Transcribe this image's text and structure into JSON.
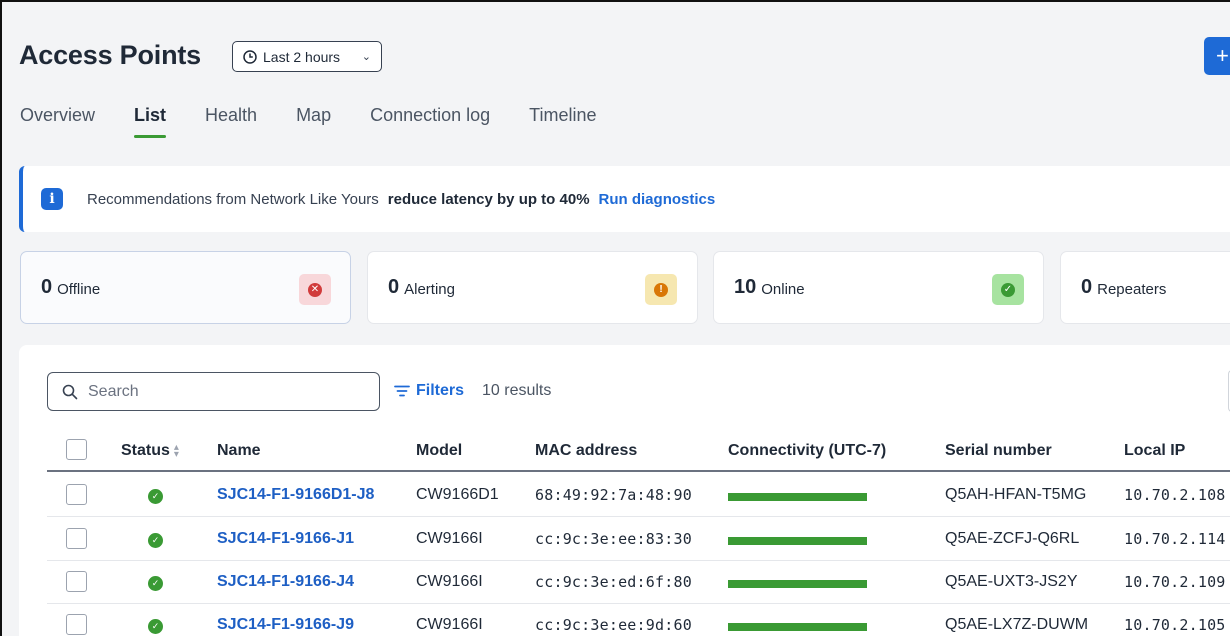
{
  "header": {
    "title": "Access Points",
    "time_range": "Last 2 hours",
    "add_button_label": "+"
  },
  "tabs": [
    {
      "label": "Overview",
      "active": false
    },
    {
      "label": "List",
      "active": true
    },
    {
      "label": "Health",
      "active": false
    },
    {
      "label": "Map",
      "active": false
    },
    {
      "label": "Connection log",
      "active": false
    },
    {
      "label": "Timeline",
      "active": false
    }
  ],
  "banner": {
    "text": "Recommendations from Network Like Yours",
    "highlight": "reduce latency by up to 40%",
    "link": "Run diagnostics",
    "icon": "info-icon"
  },
  "cards": [
    {
      "count": "0",
      "label": "Offline",
      "icon": "error-icon",
      "badge_bg": "#f8d7da",
      "dot_color": "#d13b3b",
      "glyph": "✕"
    },
    {
      "count": "0",
      "label": "Alerting",
      "icon": "warning-icon",
      "badge_bg": "#f6e7b0",
      "dot_color": "#d97706",
      "glyph": "!"
    },
    {
      "count": "10",
      "label": "Online",
      "icon": "check-icon",
      "badge_bg": "#a7e3a0",
      "dot_color": "#3a9a34",
      "glyph": "✓"
    },
    {
      "count": "0",
      "label": "Repeaters",
      "icon": "",
      "badge_bg": "",
      "dot_color": "",
      "glyph": ""
    }
  ],
  "toolbar": {
    "search_placeholder": "Search",
    "filters_label": "Filters",
    "results": "10 results"
  },
  "table": {
    "columns": [
      "Status",
      "Name",
      "Model",
      "MAC address",
      "Connectivity (UTC-7)",
      "Serial number",
      "Local IP"
    ],
    "rows": [
      {
        "status": "online",
        "name": "SJC14-F1-9166D1-J8",
        "model": "CW9166D1",
        "mac": "68:49:92:7a:48:90",
        "connectivity": 1.0,
        "serial": "Q5AH-HFAN-T5MG",
        "ip": "10.70.2.108"
      },
      {
        "status": "online",
        "name": "SJC14-F1-9166-J1",
        "model": "CW9166I",
        "mac": "cc:9c:3e:ee:83:30",
        "connectivity": 1.0,
        "serial": "Q5AE-ZCFJ-Q6RL",
        "ip": "10.70.2.114"
      },
      {
        "status": "online",
        "name": "SJC14-F1-9166-J4",
        "model": "CW9166I",
        "mac": "cc:9c:3e:ed:6f:80",
        "connectivity": 1.0,
        "serial": "Q5AE-UXT3-JS2Y",
        "ip": "10.70.2.109"
      },
      {
        "status": "online",
        "name": "SJC14-F1-9166-J9",
        "model": "CW9166I",
        "mac": "cc:9c:3e:ee:9d:60",
        "connectivity": 1.0,
        "serial": "Q5AE-LX7Z-DUWM",
        "ip": "10.70.2.105"
      }
    ]
  }
}
